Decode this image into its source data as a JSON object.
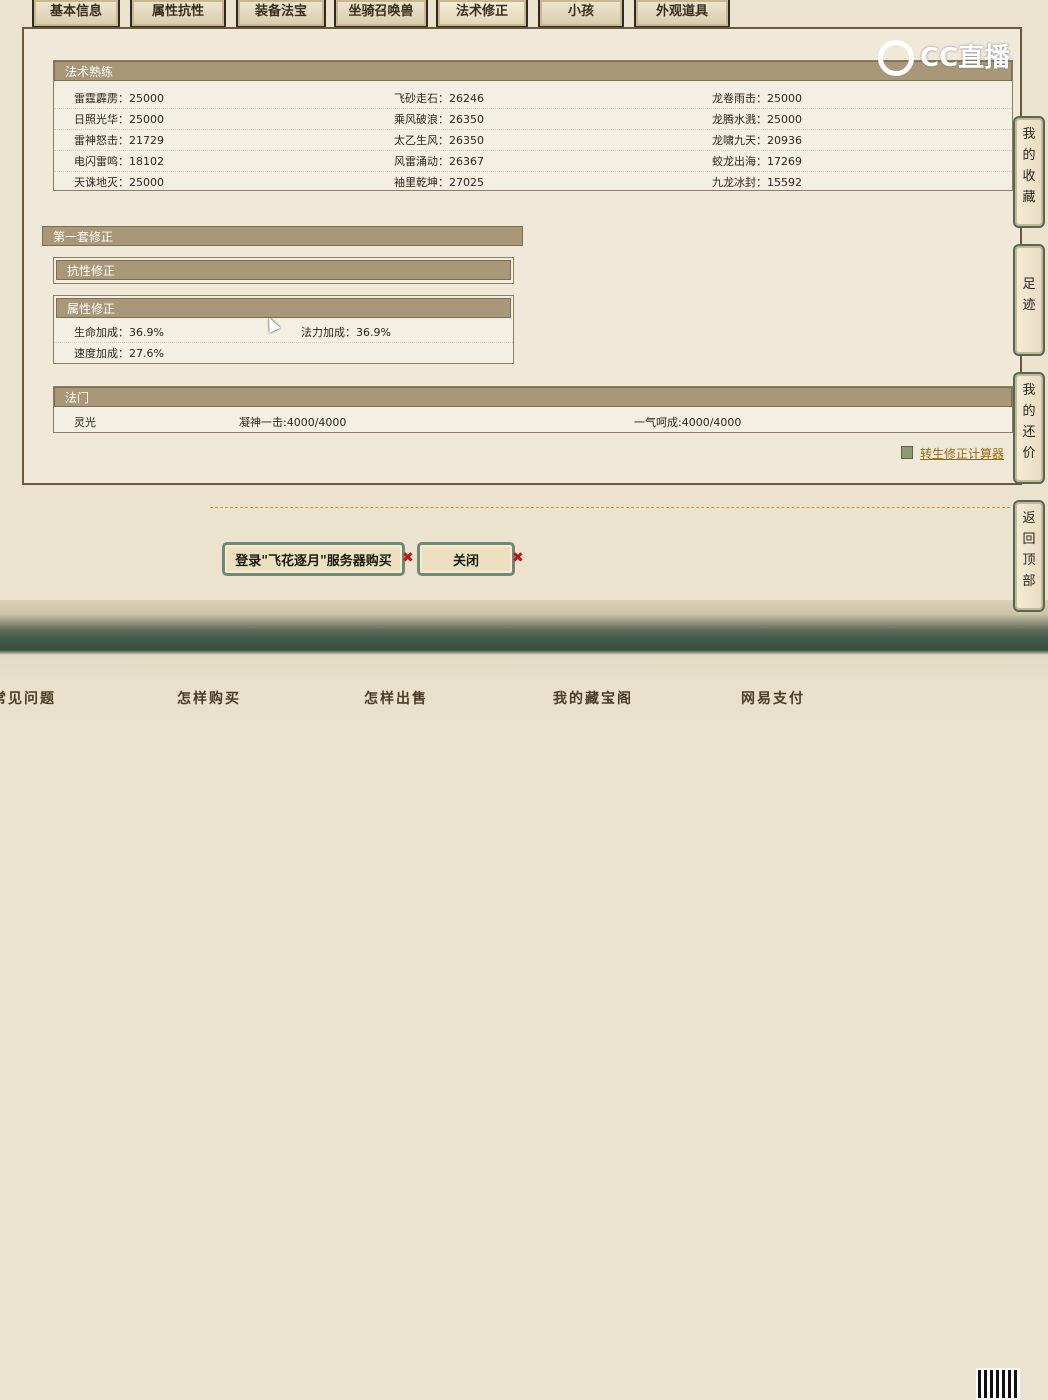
{
  "tabs": [
    "基本信息",
    "属性抗性",
    "装备法宝",
    "坐骑召唤兽",
    "法术修正",
    "小孩",
    "外观道具"
  ],
  "spell_mastery": {
    "title": "法术熟练",
    "rows": [
      [
        "雷霆霹雳：25000",
        "飞砂走石：26246",
        "龙卷雨击：25000"
      ],
      [
        "日照光华：25000",
        "乘风破浪：26350",
        "龙腾水溅：25000"
      ],
      [
        "雷神怒击：21729",
        "太乙生风：26350",
        "龙啸九天：20936"
      ],
      [
        "电闪雷鸣：18102",
        "风雷涌动：26367",
        "蛟龙出海：17269"
      ],
      [
        "天诛地灭：25000",
        "袖里乾坤：27025",
        "九龙冰封：15592"
      ]
    ]
  },
  "correction_set": {
    "title": "第一套修正",
    "resist_title": "抗性修正",
    "attr_title": "属性修正",
    "attr_rows": [
      [
        "生命加成：36.9%",
        "法力加成：36.9%"
      ],
      [
        "速度加成：27.6%",
        ""
      ]
    ]
  },
  "faction": {
    "title": "法门",
    "row": [
      "灵光",
      "凝神一击:4000/4000",
      "一气呵成:4000/4000"
    ]
  },
  "calc_link": "转生修正计算器",
  "buttons": {
    "login_buy": "登录\"飞花逐月\"服务器购买",
    "close": "关闭",
    "x_mark": "✖"
  },
  "footer": [
    "常见问题",
    "怎样购买",
    "怎样出售",
    "我的藏宝阁",
    "网易支付"
  ],
  "sidebar": {
    "favorites": "我的收藏",
    "footprints": "足迹",
    "my_offers": "我的还价",
    "back_top": "返回顶部"
  },
  "watermark": "CC直播",
  "colors": {
    "header": "#a89877",
    "panel_bg": "#f0e9da",
    "link": "#9a6a10",
    "accent_green": "#3f5a48"
  }
}
